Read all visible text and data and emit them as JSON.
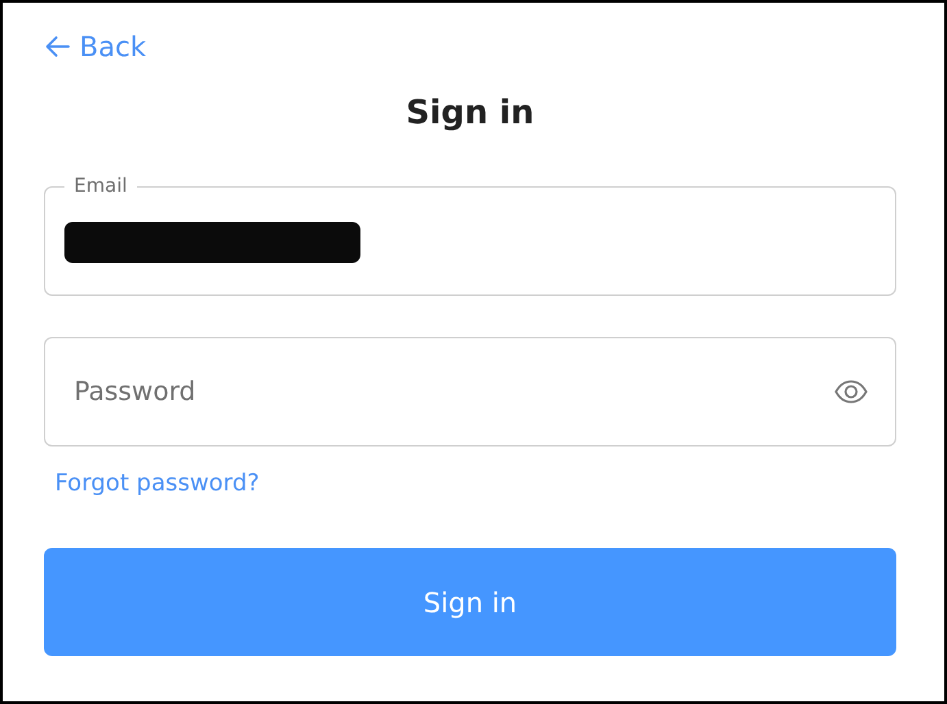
{
  "back_link": {
    "label": "Back"
  },
  "title": "Sign in",
  "email": {
    "label": "Email",
    "redacted": true
  },
  "password": {
    "placeholder": "Password"
  },
  "forgot_link": "Forgot password?",
  "submit_button": "Sign in"
}
